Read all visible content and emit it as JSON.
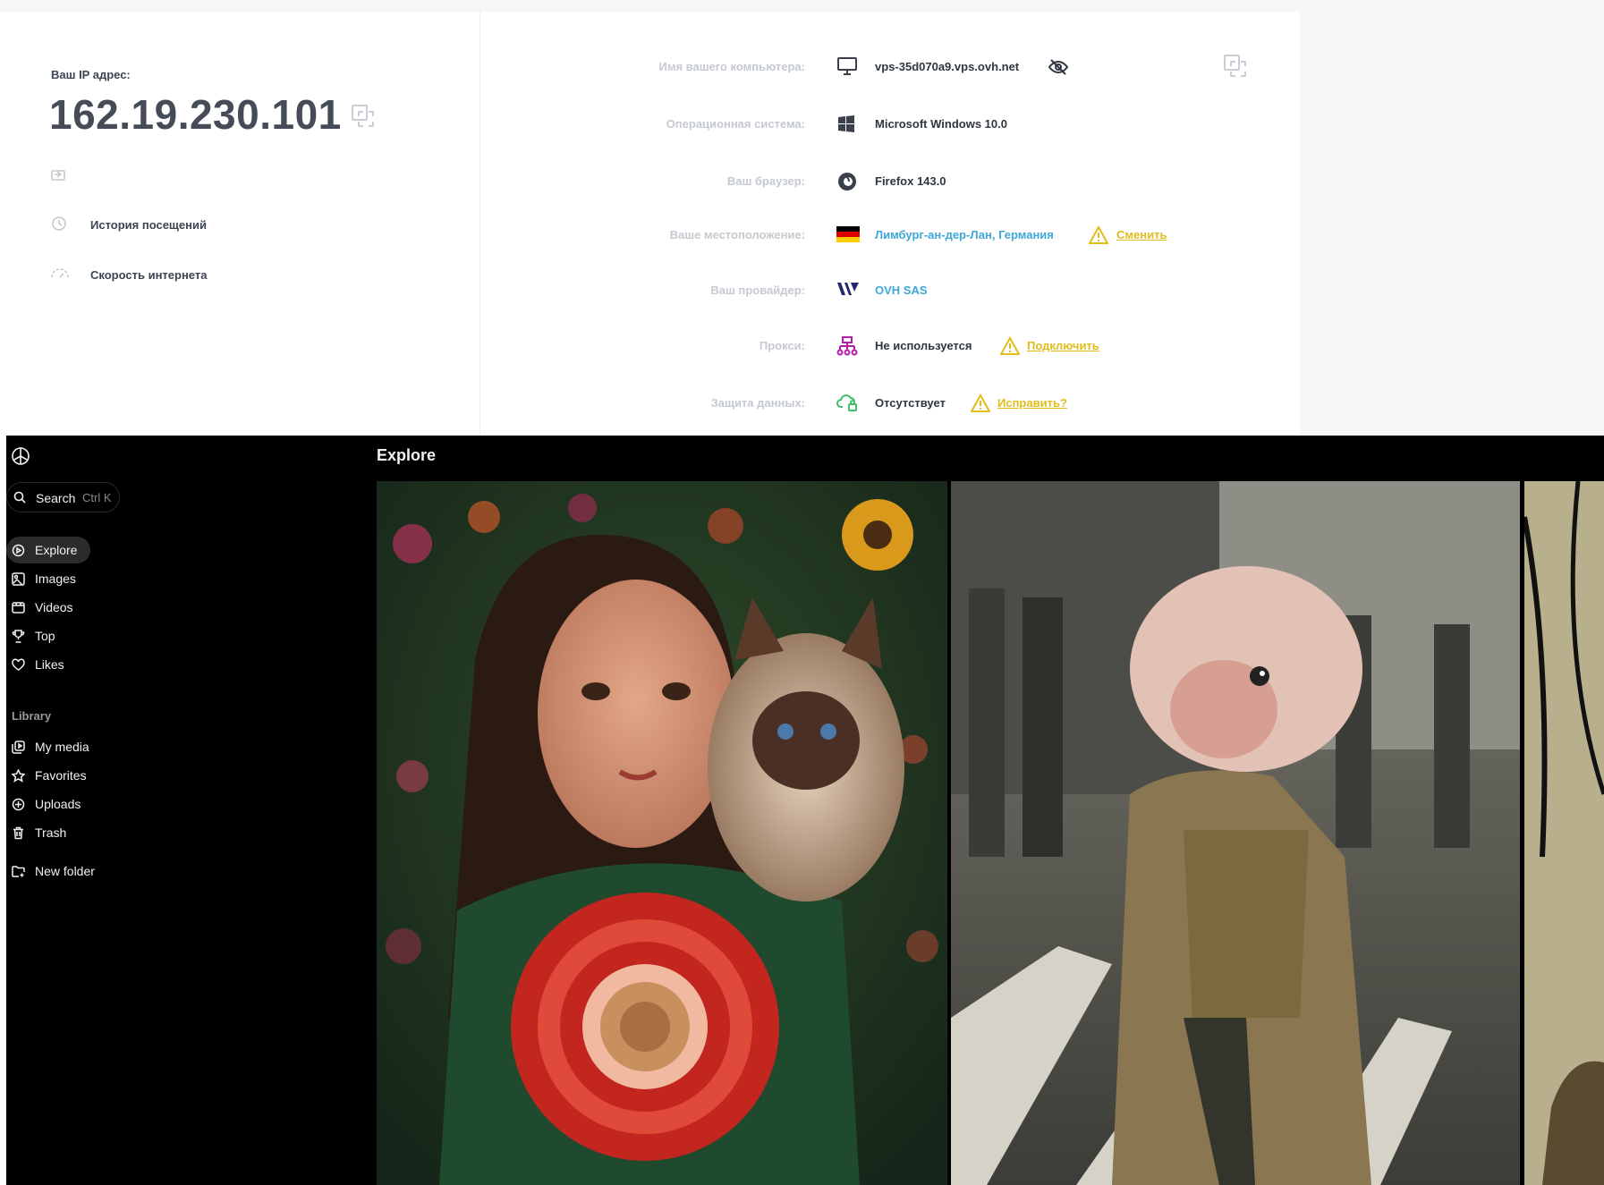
{
  "ip_page": {
    "ip_label": "Ваш IP адрес:",
    "ip_address": "162.19.230.101",
    "links": [
      {
        "label": "История посещений",
        "icon": "history-icon"
      },
      {
        "label": "Скорость интернета",
        "icon": "speed-icon"
      }
    ],
    "rows": [
      {
        "label": "Имя вашего компьютера:",
        "value": "vps-35d070a9.vps.ovh.net",
        "icon": "monitor-icon"
      },
      {
        "label": "Операционная система:",
        "value": "Microsoft Windows 10.0",
        "icon": "windows-icon"
      },
      {
        "label": "Ваш браузер:",
        "value": "Firefox 143.0",
        "icon": "firefox-icon"
      },
      {
        "label": "Ваше местоположение:",
        "value": "Лимбург-ан-дер-Лан, Германия",
        "icon": "germany-flag-icon",
        "action": "Сменить"
      },
      {
        "label": "Ваш провайдер:",
        "value": "OVH SAS",
        "icon": "ovh-logo-icon"
      },
      {
        "label": "Прокси:",
        "value": "Не используется",
        "icon": "network-icon",
        "action": "Подключить"
      },
      {
        "label": "Защита данных:",
        "value": "Отсутствует",
        "icon": "cloud-lock-icon",
        "action": "Исправить?"
      }
    ]
  },
  "app": {
    "search": {
      "label": "Search",
      "shortcut": "Ctrl K"
    },
    "nav": [
      {
        "label": "Explore",
        "icon": "explore-icon",
        "active": true
      },
      {
        "label": "Images",
        "icon": "images-icon"
      },
      {
        "label": "Videos",
        "icon": "videos-icon"
      },
      {
        "label": "Top",
        "icon": "trophy-icon"
      },
      {
        "label": "Likes",
        "icon": "heart-icon"
      }
    ],
    "library_label": "Library",
    "library": [
      {
        "label": "My media",
        "icon": "media-icon"
      },
      {
        "label": "Favorites",
        "icon": "star-icon"
      },
      {
        "label": "Uploads",
        "icon": "upload-icon"
      },
      {
        "label": "Trash",
        "icon": "trash-icon"
      }
    ],
    "new_folder": {
      "label": "New folder",
      "icon": "new-folder-icon"
    },
    "main_title": "Explore",
    "tiles": [
      {
        "name": "woman-with-cat-and-dahlia-image"
      },
      {
        "name": "blobfish-man-in-coat-image"
      },
      {
        "name": "cropped-image"
      }
    ]
  },
  "colors": {
    "accent_link": "#3ea7d8",
    "warning": "#e0bd1a",
    "app_bg": "#000000"
  }
}
